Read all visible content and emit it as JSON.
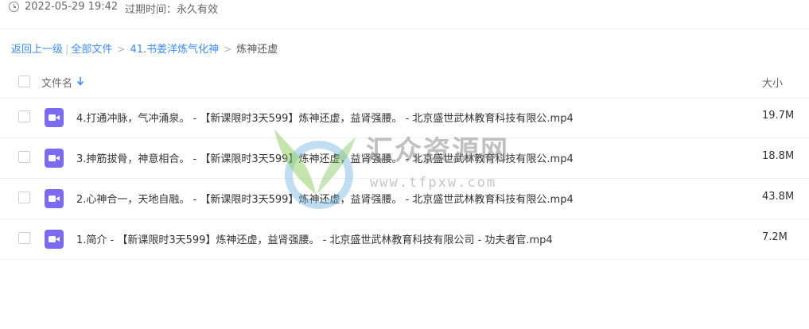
{
  "meta": {
    "date": "2022-05-29 19:42",
    "expire_text": "过期时间：永久有效"
  },
  "breadcrumb": {
    "back": "返回上一级",
    "all_files": "全部文件",
    "folder": "41.书姜洋炼气化神",
    "current": "炼神还虚"
  },
  "table": {
    "header_name": "文件名",
    "header_size": "大小",
    "files": [
      {
        "name": "4.打通冲脉，气冲涌泉。 - 【新课限时3天599】炼神还虚，益肾强腰。 - 北京盛世武林教育科技有限公.mp4",
        "size": "19.7M"
      },
      {
        "name": "3.抻筋拔骨，神意相合。 - 【新课限时3天599】炼神还虚，益肾强腰。 - 北京盛世武林教育科技有限公.mp4",
        "size": "18.8M"
      },
      {
        "name": "2.心神合一，天地自融。 - 【新课限时3天599】炼神还虚，益肾强腰。 - 北京盛世武林教育科技有限公.mp4",
        "size": "43.8M"
      },
      {
        "name": "1.简介 - 【新课限时3天599】炼神还虚，益肾强腰。 - 北京盛世武林教育科技有限公司 - 功夫者官.mp4",
        "size": "7.2M"
      }
    ]
  },
  "watermark": {
    "text": "汇众资源网",
    "url": "www.tfpxw.com"
  },
  "colors": {
    "link": "#3b8cff",
    "video_icon": "#7a6bf2"
  },
  "icons": {
    "clock": "clock-icon",
    "sort": "arrow-down-icon",
    "video": "video-file-icon"
  }
}
